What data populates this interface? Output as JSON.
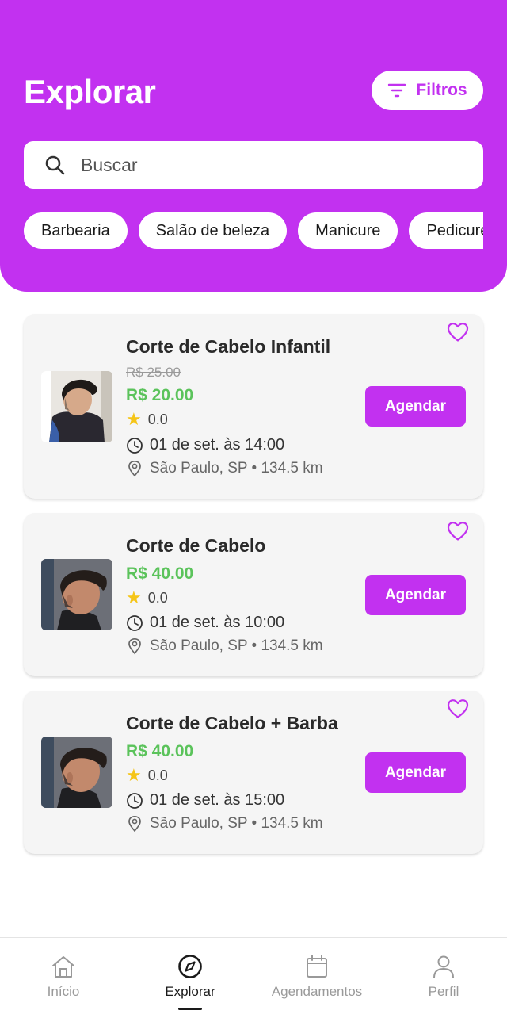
{
  "header": {
    "title": "Explorar",
    "filter_label": "Filtros"
  },
  "search": {
    "placeholder": "Buscar",
    "value": ""
  },
  "categories": [
    "Barbearia",
    "Salão de beleza",
    "Manicure",
    "Pedicure"
  ],
  "colors": {
    "brand": "#C231F0",
    "price": "#5BC35B",
    "star": "#F5C518",
    "card_bg": "#F5F5F5"
  },
  "services": [
    {
      "name": "Corte de Cabelo Infantil",
      "old_price": "R$ 25.00",
      "price": "R$ 20.00",
      "rating": "0.0",
      "datetime": "01 de set. às 14:00",
      "location": "São Paulo, SP • 134.5 km",
      "button": "Agendar",
      "favorite_icon": "heart-outline-icon"
    },
    {
      "name": "Corte de Cabelo",
      "price": "R$ 40.00",
      "rating": "0.0",
      "datetime": "01 de set. às 10:00",
      "location": "São Paulo, SP • 134.5 km",
      "button": "Agendar",
      "favorite_icon": "heart-outline-icon"
    },
    {
      "name": "Corte de Cabelo + Barba",
      "price": "R$ 40.00",
      "rating": "0.0",
      "datetime": "01 de set. às 15:00",
      "location": "São Paulo, SP • 134.5 km",
      "button": "Agendar",
      "favorite_icon": "heart-outline-icon"
    }
  ],
  "nav": {
    "items": [
      {
        "label": "Início",
        "icon": "home-icon",
        "active": false
      },
      {
        "label": "Explorar",
        "icon": "compass-icon",
        "active": true
      },
      {
        "label": "Agendamentos",
        "icon": "calendar-icon",
        "active": false
      },
      {
        "label": "Perfil",
        "icon": "user-icon",
        "active": false
      }
    ]
  }
}
